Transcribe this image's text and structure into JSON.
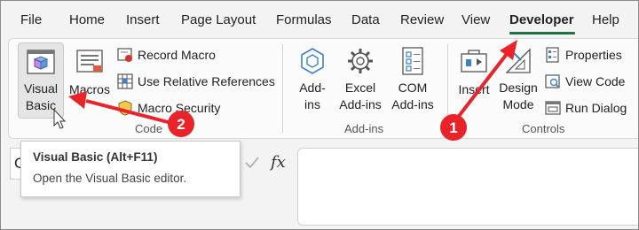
{
  "menu": {
    "items": [
      "File",
      "Home",
      "Insert",
      "Page Layout",
      "Formulas",
      "Data",
      "Review",
      "View",
      "Developer",
      "Help"
    ],
    "active": "Developer",
    "active_color": "#1e7145"
  },
  "ribbon": {
    "code": {
      "label": "Code",
      "visual_basic": [
        "Visual",
        "Basic"
      ],
      "macros": "Macros",
      "record_macro": "Record Macro",
      "use_relative_references": "Use Relative References",
      "macro_security": "Macro Security"
    },
    "addins": {
      "label": "Add-ins",
      "addins": [
        "Add-",
        "ins"
      ],
      "excel_addins": [
        "Excel",
        "Add-ins"
      ],
      "com_addins": [
        "COM",
        "Add-ins"
      ]
    },
    "controls": {
      "label": "Controls",
      "insert": "Insert",
      "design_mode": [
        "Design",
        "Mode"
      ],
      "properties": "Properties",
      "view_code": "View Code",
      "run_dialog": "Run Dialog"
    }
  },
  "formula_bar": {
    "name_box_value": "C",
    "fx_label": "fx"
  },
  "tooltip": {
    "title": "Visual Basic (Alt+F11)",
    "description": "Open the Visual Basic editor."
  },
  "annotations": {
    "color": "#e8232a",
    "badge_1": "1",
    "badge_2": "2"
  },
  "icons": [
    "visual-basic-icon",
    "macros-icon",
    "record-macro-icon",
    "relative-references-icon",
    "macro-security-icon",
    "addins-hexagon-icon",
    "gear-icon",
    "com-addins-icon",
    "insert-controls-icon",
    "design-mode-icon",
    "properties-icon",
    "view-code-icon",
    "run-dialog-icon",
    "checkmark-icon",
    "mouse-cursor-icon"
  ]
}
